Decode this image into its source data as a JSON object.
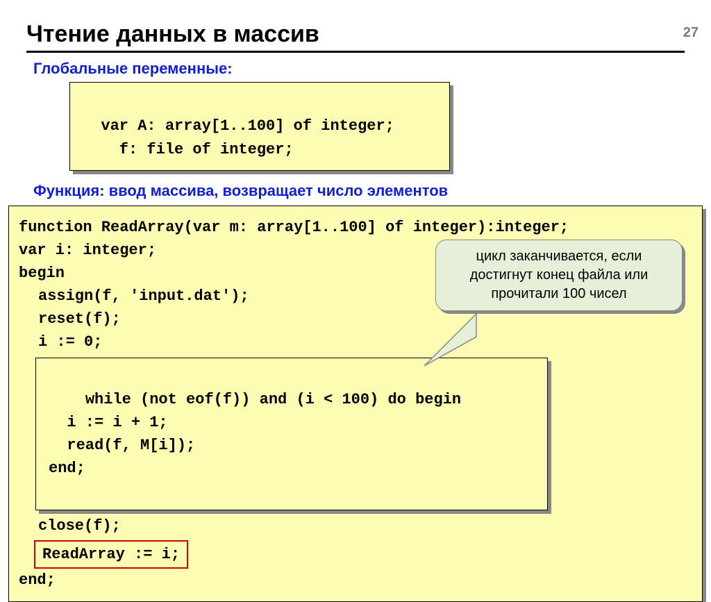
{
  "page_number": "27",
  "title": "Чтение данных в массив",
  "subhead1": "Глобальные переменные:",
  "globals_code": "var A: array[1..100] of integer;\n    f: file of integer;",
  "subhead2": "Функция: ввод массива, возвращает число элементов",
  "func": {
    "l1": "function ReadArray(var m: array[1..100] of integer):integer;",
    "l2": "var i: integer;",
    "l3": "begin",
    "l4": "assign(f, 'input.dat');",
    "l5": "reset(f);",
    "l6": "i := 0;",
    "loop": "while (not eof(f)) and (i < 100) do begin\n  i := i + 1;\n  read(f, M[i]);\nend;",
    "l7": "close(f);",
    "l8": "ReadArray := i;",
    "l9": "end;"
  },
  "callout_text": "цикл заканчивается, если достигнут конец файла или прочитали 100 чисел"
}
